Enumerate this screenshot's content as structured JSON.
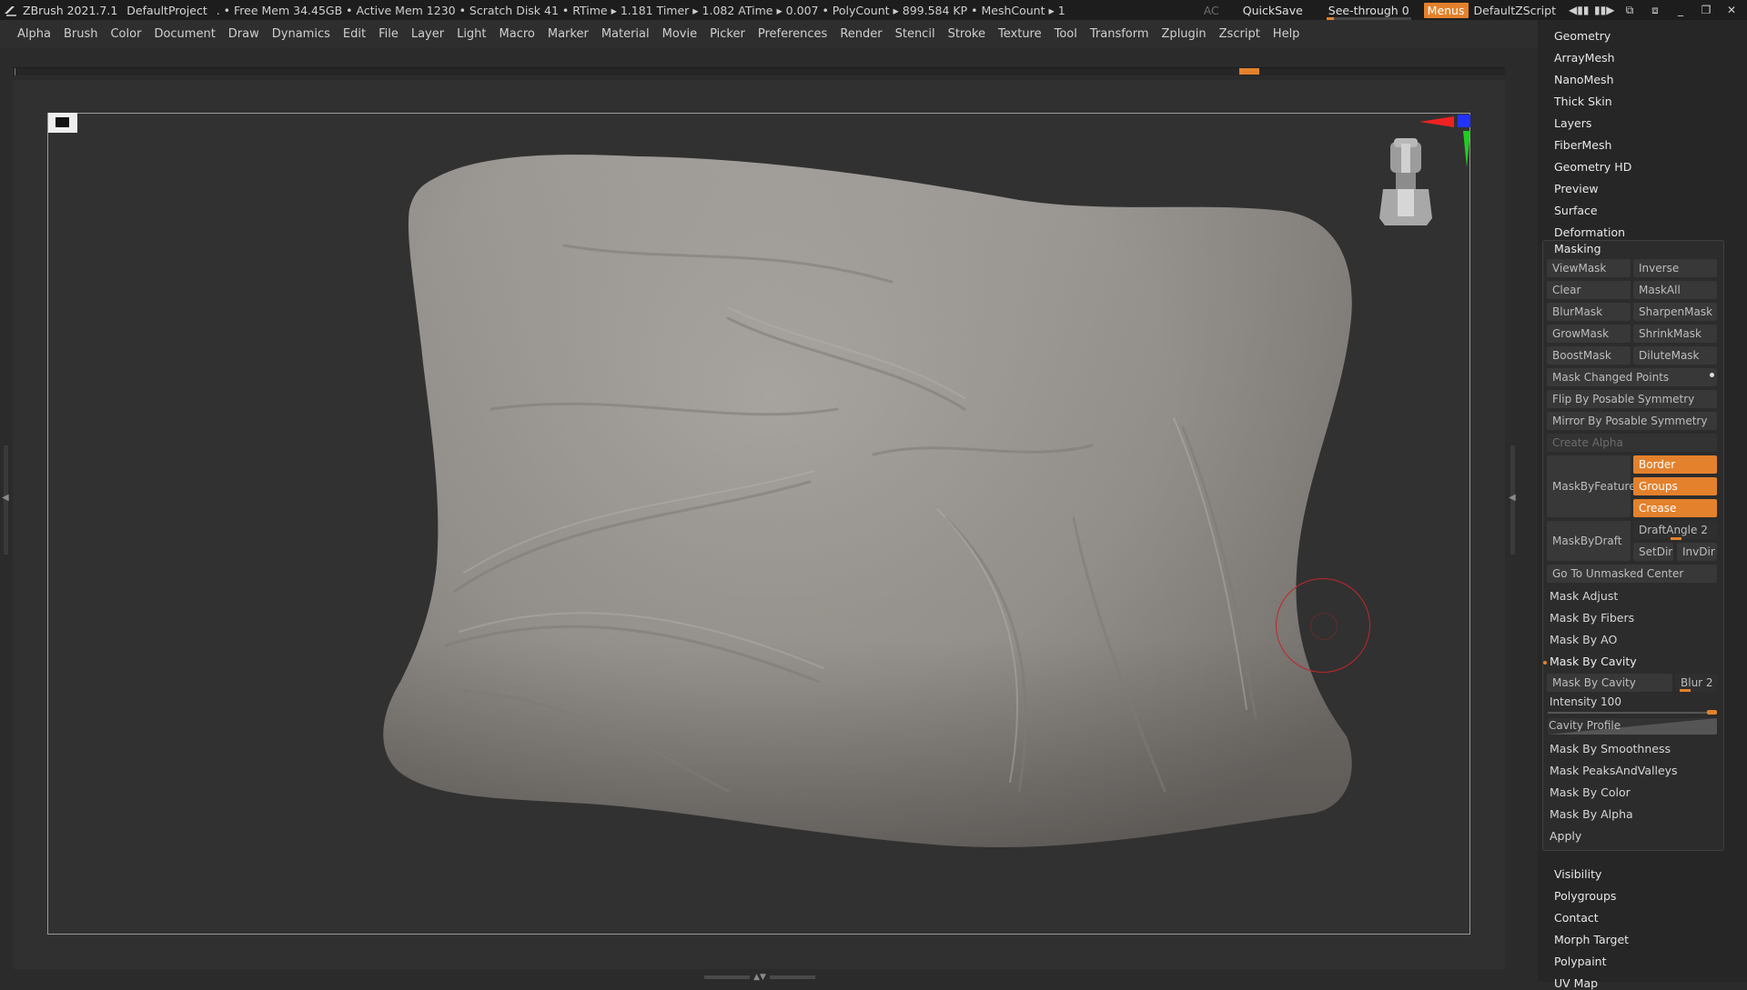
{
  "titlebar": {
    "app": "ZBrush 2021.7.1",
    "project": "DefaultProject",
    "stats": ". • Free Mem 34.45GB • Active Mem 1230 • Scratch Disk 41 •  RTime ▸ 1.181 Timer ▸ 1.082 ATime ▸ 0.007 • PolyCount ▸ 899.584 KP  • MeshCount ▸ 1",
    "ac": "AC",
    "quicksave": "QuickSave",
    "seethrough": "See-through  0",
    "menus": "Menus",
    "script": "DefaultZScript",
    "accent": "#e3812c"
  },
  "menubar": [
    "Alpha",
    "Brush",
    "Color",
    "Document",
    "Draw",
    "Dynamics",
    "Edit",
    "File",
    "Layer",
    "Light",
    "Macro",
    "Marker",
    "Material",
    "Movie",
    "Picker",
    "Preferences",
    "Render",
    "Stencil",
    "Stroke",
    "Texture",
    "Tool",
    "Transform",
    "Zplugin",
    "Zscript",
    "Help"
  ],
  "palette": {
    "top_items": [
      "Geometry",
      "ArrayMesh",
      "NanoMesh",
      "Thick Skin",
      "Layers",
      "FiberMesh",
      "Geometry HD",
      "Preview",
      "Surface",
      "Deformation"
    ],
    "masking": {
      "title": "Masking",
      "viewmask": "ViewMask",
      "inverse": "Inverse",
      "clear": "Clear",
      "maskall": "MaskAll",
      "blurmask": "BlurMask",
      "sharpenmask": "SharpenMask",
      "growmask": "GrowMask",
      "shrinkmask": "ShrinkMask",
      "boostmask": "BoostMask",
      "dilutemask": "DiluteMask",
      "mask_changed_points": "Mask Changed Points",
      "flip_posable": "Flip By Posable Symmetry",
      "mirror_posable": "Mirror By Posable Symmetry",
      "create_alpha": "Create Alpha",
      "maskbyfeature": "MaskByFeature",
      "border": "Border",
      "groups": "Groups",
      "crease": "Crease",
      "maskbydraft": "MaskByDraft",
      "draftangle": "DraftAngle 2",
      "setdir": "SetDir",
      "invdir": "InvDir",
      "go_unmasked": "Go To Unmasked Center",
      "mask_adjust": "Mask Adjust",
      "mask_fibers": "Mask By Fibers",
      "mask_ao": "Mask By AO",
      "mask_cavity_header": "Mask By Cavity",
      "mask_cavity_btn": "Mask By Cavity",
      "blur": "Blur 2",
      "intensity": "Intensity 100",
      "intensity_level": 1.0,
      "cavity_profile": "Cavity Profile",
      "mask_smoothness": "Mask By Smoothness",
      "mask_peaks": "Mask PeaksAndValleys",
      "mask_color": "Mask By Color",
      "mask_alpha": "Mask By Alpha",
      "apply": "Apply"
    },
    "bottom_items": [
      "Visibility",
      "Polygroups",
      "Contact",
      "Morph Target",
      "Polypaint",
      "UV Map"
    ]
  }
}
